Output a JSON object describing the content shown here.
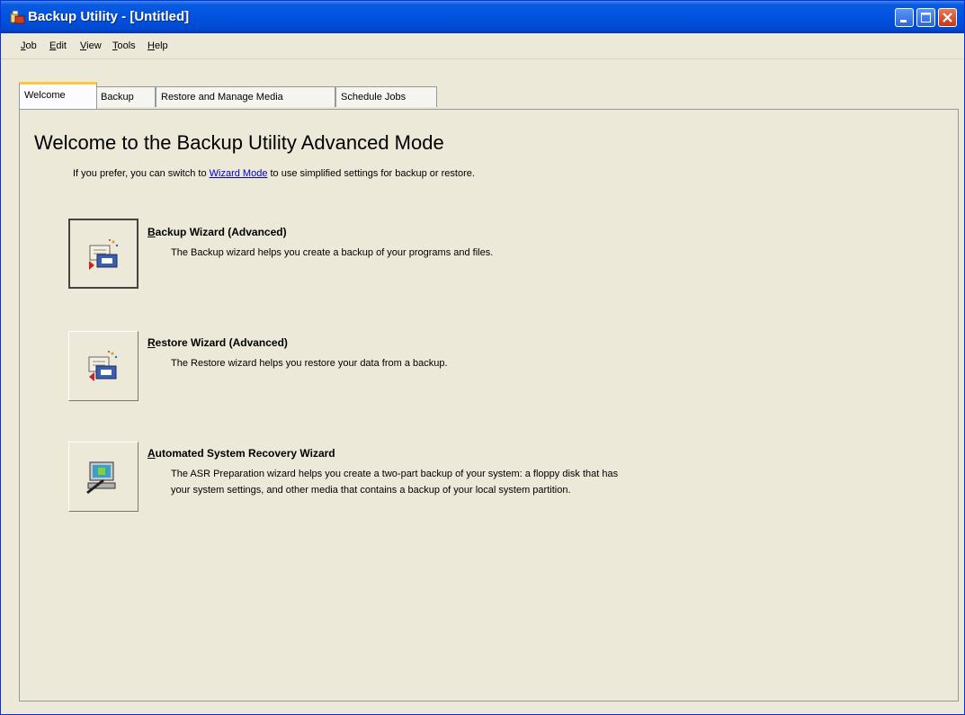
{
  "window": {
    "title": "Backup Utility - [Untitled]"
  },
  "menu": [
    {
      "key": "J",
      "rest": "ob"
    },
    {
      "key": "E",
      "rest": "dit"
    },
    {
      "key": "V",
      "rest": "iew"
    },
    {
      "key": "T",
      "rest": "ools"
    },
    {
      "key": "H",
      "rest": "elp"
    }
  ],
  "tabs": [
    "Welcome",
    "Backup",
    "Restore and Manage Media",
    "Schedule Jobs"
  ],
  "active_tab": "Welcome",
  "welcome": {
    "heading": "Welcome to the Backup Utility Advanced Mode",
    "intro_before": "If you prefer, you can switch to ",
    "intro_link": "Wizard Mode",
    "intro_after": " to use simplified settings for backup or restore."
  },
  "wizards": [
    {
      "key": "B",
      "title_rest": "ackup Wizard (Advanced)",
      "desc": [
        "The Backup wizard helps you create a backup of your programs and files."
      ],
      "icon": "backup-wizard-icon"
    },
    {
      "key": "R",
      "title_rest": "estore Wizard (Advanced)",
      "desc": [
        "The Restore wizard helps you restore your data from a backup."
      ],
      "icon": "restore-wizard-icon"
    },
    {
      "key": "A",
      "title_rest": "utomated System Recovery Wizard",
      "desc": [
        "The ASR Preparation wizard helps you create a two-part backup of your system: a floppy disk that has",
        "your system settings, and other media that contains a backup of your local system partition."
      ],
      "icon": "asr-wizard-icon"
    }
  ],
  "colors": {
    "titlebar": "#0053e0",
    "face": "#ece9d8",
    "tab_highlight": "#ffc83c",
    "link": "#0000cc"
  }
}
